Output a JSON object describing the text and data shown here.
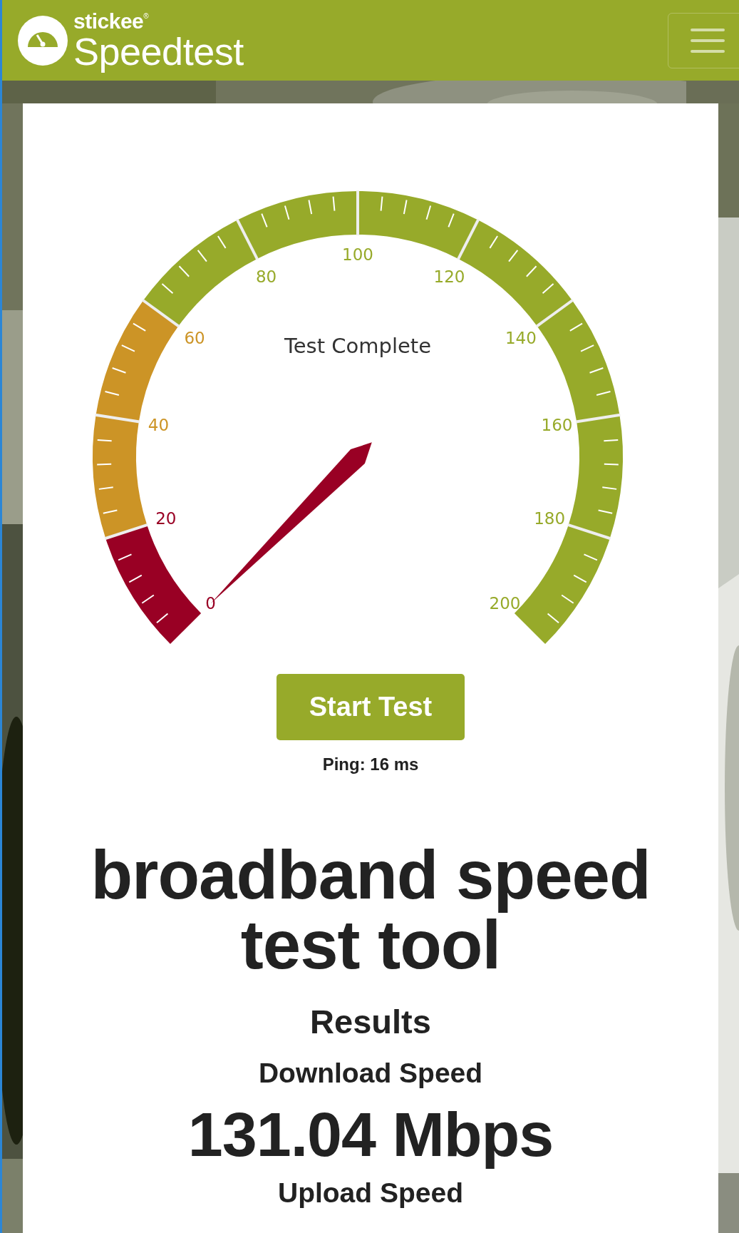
{
  "navbar": {
    "brand_top": "stickee",
    "brand_mark": "®",
    "brand_main": "Speedtest"
  },
  "gauge": {
    "status": "Test Complete",
    "scale_labels": [
      {
        "text": "0",
        "color": "#990024"
      },
      {
        "text": "20",
        "color": "#990024"
      },
      {
        "text": "40",
        "color": "#cc9426"
      },
      {
        "text": "60",
        "color": "#cc9426"
      },
      {
        "text": "80",
        "color": "#97aa2a"
      },
      {
        "text": "100",
        "color": "#97aa2a"
      },
      {
        "text": "120",
        "color": "#97aa2a"
      },
      {
        "text": "140",
        "color": "#97aa2a"
      },
      {
        "text": "160",
        "color": "#97aa2a"
      },
      {
        "text": "180",
        "color": "#97aa2a"
      },
      {
        "text": "200",
        "color": "#97aa2a"
      }
    ]
  },
  "start_button": "Start Test",
  "ping": "Ping: 16 ms",
  "heading": "broadband speed test tool",
  "results": {
    "title": "Results",
    "download_label": "Download Speed",
    "download_value": "131.04 Mbps",
    "upload_label": "Upload Speed"
  }
}
